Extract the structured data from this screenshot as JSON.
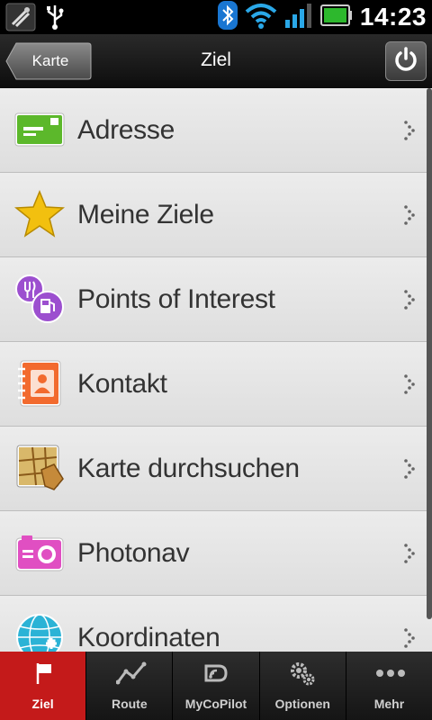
{
  "status": {
    "time": "14:23"
  },
  "header": {
    "back_label": "Karte",
    "title": "Ziel"
  },
  "menu": {
    "items": [
      {
        "label": "Adresse",
        "icon": "address-card-icon"
      },
      {
        "label": "Meine Ziele",
        "icon": "star-icon"
      },
      {
        "label": "Points of Interest",
        "icon": "poi-icon"
      },
      {
        "label": "Kontakt",
        "icon": "contact-book-icon"
      },
      {
        "label": "Karte durchsuchen",
        "icon": "map-search-icon"
      },
      {
        "label": "Photonav",
        "icon": "camera-icon"
      },
      {
        "label": "Koordinaten",
        "icon": "globe-icon"
      }
    ]
  },
  "tabs": [
    {
      "label": "Ziel",
      "icon": "flag-icon"
    },
    {
      "label": "Route",
      "icon": "route-icon"
    },
    {
      "label": "MyCoPilot",
      "icon": "mycopilot-icon"
    },
    {
      "label": "Optionen",
      "icon": "gears-icon"
    },
    {
      "label": "Mehr",
      "icon": "more-dots-icon"
    }
  ],
  "colors": {
    "active_tab": "#c41a1a",
    "list_bg": "#e4e4e4",
    "bar_bg": "#1a1a1a"
  }
}
